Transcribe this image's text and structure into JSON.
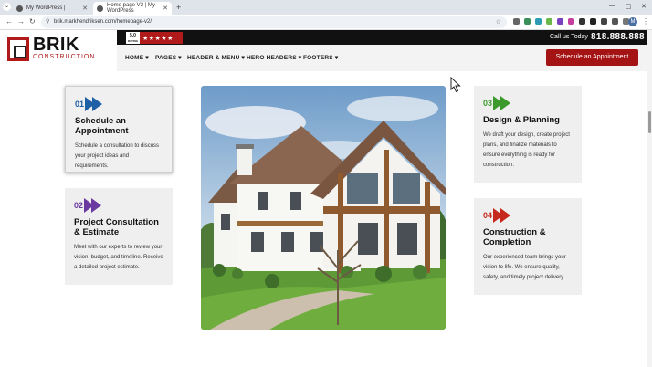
{
  "browser": {
    "tabs": [
      {
        "title": "My WordPress |",
        "active": false
      },
      {
        "title": "Home page V2 | My WordPress",
        "active": true
      }
    ],
    "url": "brik.markhendriksen.com/homepage-v2/",
    "profile_initial": "M"
  },
  "header": {
    "logo_main": "BRIK",
    "logo_sub": "CONSTRUCTION",
    "rating_value": "5.0",
    "rating_label": "RATING",
    "stars": "★★★★★",
    "call_label": "Call us Today",
    "phone": "818.888.888",
    "nav": [
      "HOME",
      "PAGES",
      "HEADER & MENU",
      "HERO HEADERS",
      "FOOTERS"
    ],
    "cta": "Schedule an Appointment"
  },
  "steps": [
    {
      "num": "01",
      "title": "Schedule an Appointment",
      "text": "Schedule a consultation to discuss your project ideas and requirements.",
      "color": "#1f5fa6"
    },
    {
      "num": "02",
      "title": "Project Consultation & Estimate",
      "text": "Meet with our experts to review your vision, budget, and timeline. Receive a detailed project estimate.",
      "color": "#6b3aa0"
    },
    {
      "num": "03",
      "title": "Design & Planning",
      "text": "We draft your design, create project plans, and finalize materials to ensure everything is ready for construction.",
      "color": "#3c9a2c"
    },
    {
      "num": "04",
      "title": "Construction & Completion",
      "text": "Our experienced team brings your vision to life. We ensure quality, safety, and timely project delivery.",
      "color": "#c6281d"
    }
  ],
  "colors": {
    "brand_red": "#a51414",
    "dark": "#111111"
  }
}
